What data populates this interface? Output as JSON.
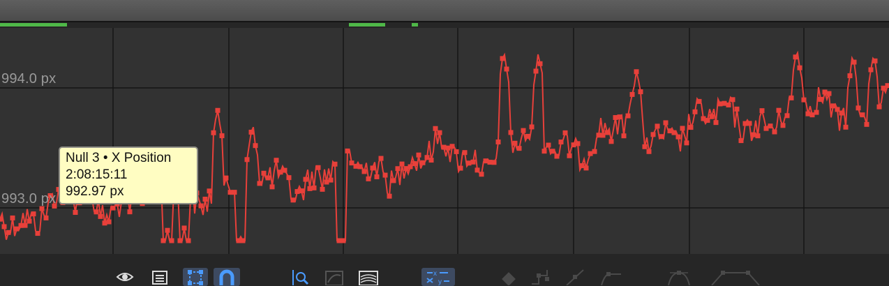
{
  "graph": {
    "value_labels": [
      "994.0 px",
      "993.0 px"
    ],
    "series_color": "#e8403a",
    "background_color": "#323232",
    "grid_color": "#141414",
    "work_area_color": "#4fb848"
  },
  "tooltip": {
    "line1": "Null 3 • X Position",
    "line2": "2:08:15:11",
    "line3": "992.97 px"
  },
  "toolbar": {
    "buttons": [
      {
        "name": "eye-icon",
        "active": false
      },
      {
        "name": "properties-list-icon",
        "active": false
      },
      {
        "name": "transform-box-icon",
        "active": true
      },
      {
        "name": "snap-magnet-icon",
        "active": true
      },
      {
        "name": "fit-zoom-icon",
        "active": false
      },
      {
        "name": "fit-selection-icon",
        "active": false
      },
      {
        "name": "fit-all-graphs-icon",
        "active": false
      },
      {
        "name": "separate-dimensions-icon",
        "active": true
      },
      {
        "name": "edit-keyframe-icon",
        "active": false
      },
      {
        "name": "convert-hold-icon",
        "active": false
      },
      {
        "name": "convert-linear-icon",
        "active": false
      },
      {
        "name": "easy-ease-icon",
        "active": false
      },
      {
        "name": "easy-ease-in-icon",
        "active": false
      },
      {
        "name": "easy-ease-out-icon",
        "active": false
      }
    ]
  }
}
